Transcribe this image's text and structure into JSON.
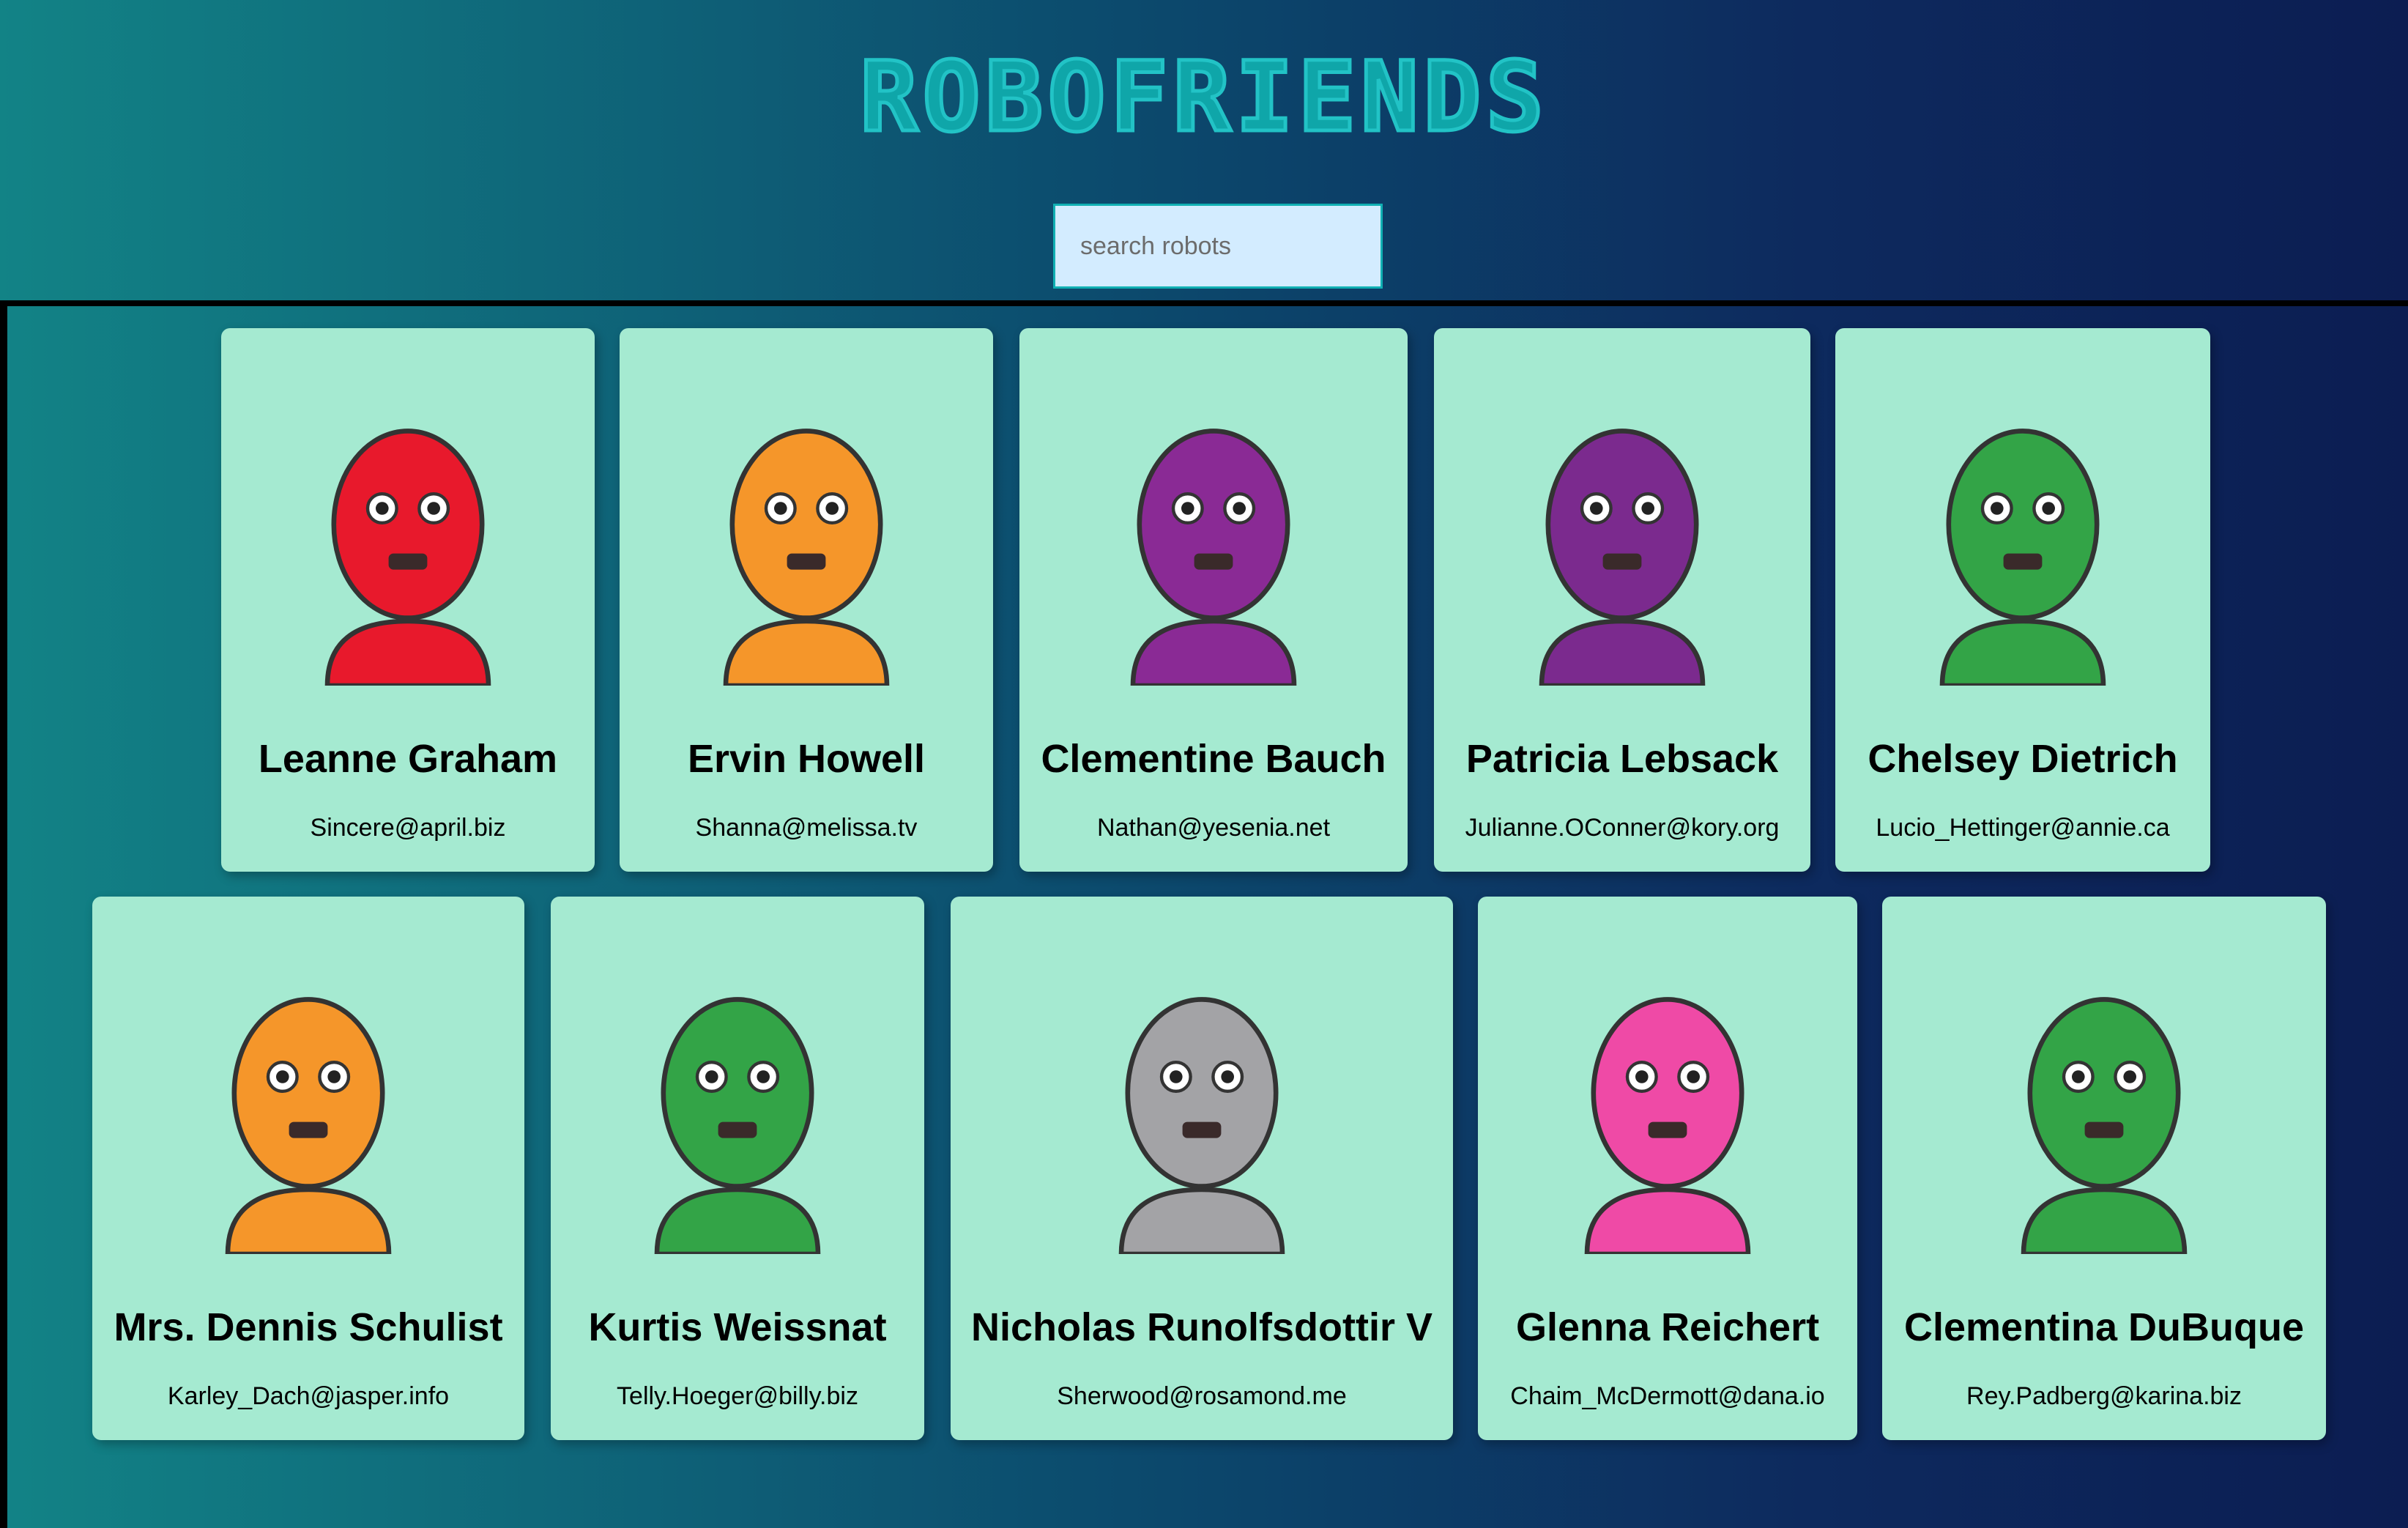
{
  "app": {
    "title": "ROBOFRIENDS"
  },
  "search": {
    "placeholder": "search robots",
    "value": ""
  },
  "robots": [
    {
      "name": "Leanne Graham",
      "email": "Sincere@april.biz",
      "color": "#e8192c",
      "icon": "robot-avatar"
    },
    {
      "name": "Ervin Howell",
      "email": "Shanna@melissa.tv",
      "color": "#f5962a",
      "icon": "robot-avatar"
    },
    {
      "name": "Clementine Bauch",
      "email": "Nathan@yesenia.net",
      "color": "#8a2a95",
      "icon": "robot-avatar"
    },
    {
      "name": "Patricia Lebsack",
      "email": "Julianne.OConner@kory.org",
      "color": "#7b2a8e",
      "icon": "robot-avatar"
    },
    {
      "name": "Chelsey Dietrich",
      "email": "Lucio_Hettinger@annie.ca",
      "color": "#33a447",
      "icon": "robot-avatar"
    },
    {
      "name": "Mrs. Dennis Schulist",
      "email": "Karley_Dach@jasper.info",
      "color": "#f5962a",
      "icon": "robot-avatar"
    },
    {
      "name": "Kurtis Weissnat",
      "email": "Telly.Hoeger@billy.biz",
      "color": "#33a447",
      "icon": "robot-avatar"
    },
    {
      "name": "Nicholas Runolfsdottir V",
      "email": "Sherwood@rosamond.me",
      "color": "#a3a3a6",
      "icon": "robot-avatar"
    },
    {
      "name": "Glenna Reichert",
      "email": "Chaim_McDermott@dana.io",
      "color": "#ef4aa6",
      "icon": "robot-avatar"
    },
    {
      "name": "Clementina DuBuque",
      "email": "Rey.Padberg@karina.biz",
      "color": "#33a447",
      "icon": "robot-avatar"
    }
  ]
}
